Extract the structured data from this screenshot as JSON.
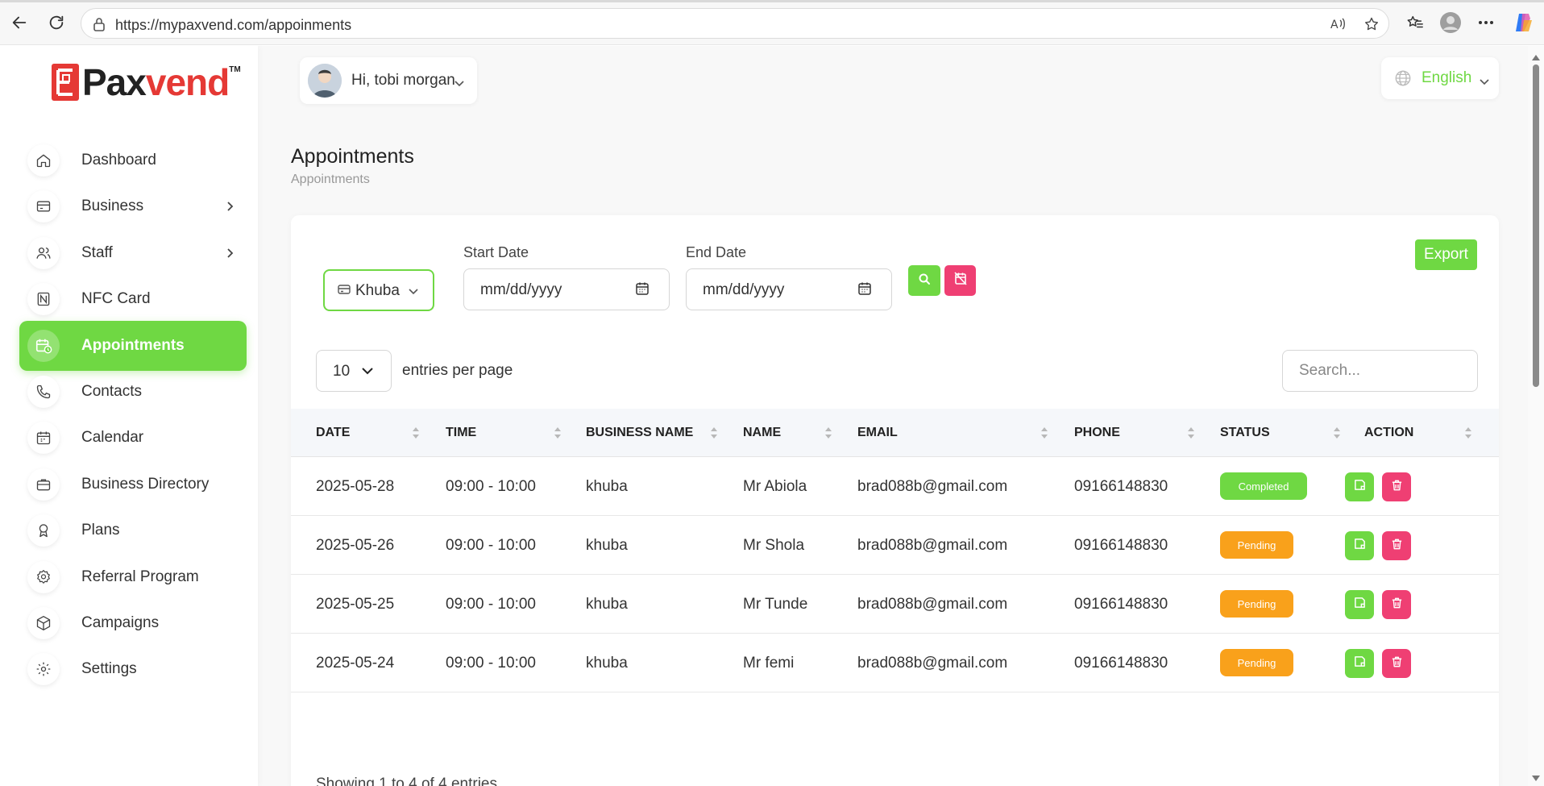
{
  "browser": {
    "url": "https://mypaxvend.com/appoinments",
    "read_aloud_icon": "read-aloud-icon",
    "favorite_icon": "star-icon"
  },
  "brand": {
    "name_part1": "Pax",
    "name_part2": "vend",
    "tm": "TM",
    "accent": "#6fd843",
    "logo_red": "#e53935"
  },
  "sidebar": {
    "items": [
      {
        "label": "Dashboard",
        "icon": "home-icon",
        "chevron": false,
        "active": false
      },
      {
        "label": "Business",
        "icon": "card-icon",
        "chevron": true,
        "active": false
      },
      {
        "label": "Staff",
        "icon": "users-icon",
        "chevron": true,
        "active": false
      },
      {
        "label": "NFC Card",
        "icon": "nfc-icon",
        "chevron": false,
        "active": false
      },
      {
        "label": "Appointments",
        "icon": "calendar-clock-icon",
        "chevron": false,
        "active": true
      },
      {
        "label": "Contacts",
        "icon": "phone-icon",
        "chevron": false,
        "active": false
      },
      {
        "label": "Calendar",
        "icon": "calendar-icon",
        "chevron": false,
        "active": false
      },
      {
        "label": "Business Directory",
        "icon": "briefcase-icon",
        "chevron": false,
        "active": false
      },
      {
        "label": "Plans",
        "icon": "award-icon",
        "chevron": false,
        "active": false
      },
      {
        "label": "Referral Program",
        "icon": "gear-badge-icon",
        "chevron": false,
        "active": false
      },
      {
        "label": "Campaigns",
        "icon": "box-icon",
        "chevron": false,
        "active": false
      },
      {
        "label": "Settings",
        "icon": "gear-icon",
        "chevron": false,
        "active": false
      }
    ]
  },
  "header": {
    "greeting": "Hi, tobi morgan",
    "language": "English"
  },
  "page": {
    "title": "Appointments",
    "breadcrumb": "Appointments"
  },
  "filters": {
    "business": "Khuba",
    "start_label": "Start Date",
    "end_label": "End Date",
    "start_placeholder": "mm/dd/yyyy",
    "end_placeholder": "mm/dd/yyyy",
    "export_label": "Export"
  },
  "table_controls": {
    "per_page": "10",
    "per_page_label": "entries per page",
    "search_placeholder": "Search..."
  },
  "table": {
    "columns": [
      "DATE",
      "TIME",
      "BUSINESS NAME",
      "NAME",
      "EMAIL",
      "PHONE",
      "STATUS",
      "ACTION"
    ],
    "rows": [
      {
        "date": "2025-05-28",
        "time": "09:00 - 10:00",
        "business": "khuba",
        "name": "Mr Abiola",
        "email": "brad088b@gmail.com",
        "phone": "09166148830",
        "status": "Completed"
      },
      {
        "date": "2025-05-26",
        "time": "09:00 - 10:00",
        "business": "khuba",
        "name": "Mr Shola",
        "email": "brad088b@gmail.com",
        "phone": "09166148830",
        "status": "Pending"
      },
      {
        "date": "2025-05-25",
        "time": "09:00 - 10:00",
        "business": "khuba",
        "name": "Mr Tunde",
        "email": "brad088b@gmail.com",
        "phone": "09166148830",
        "status": "Pending"
      },
      {
        "date": "2025-05-24",
        "time": "09:00 - 10:00",
        "business": "khuba",
        "name": "Mr femi",
        "email": "brad088b@gmail.com",
        "phone": "09166148830",
        "status": "Pending"
      }
    ],
    "footer": "Showing 1 to 4 of 4 entries"
  },
  "colors": {
    "completed": "#6fd843",
    "pending": "#f9a11b",
    "danger": "#ef3f73"
  }
}
